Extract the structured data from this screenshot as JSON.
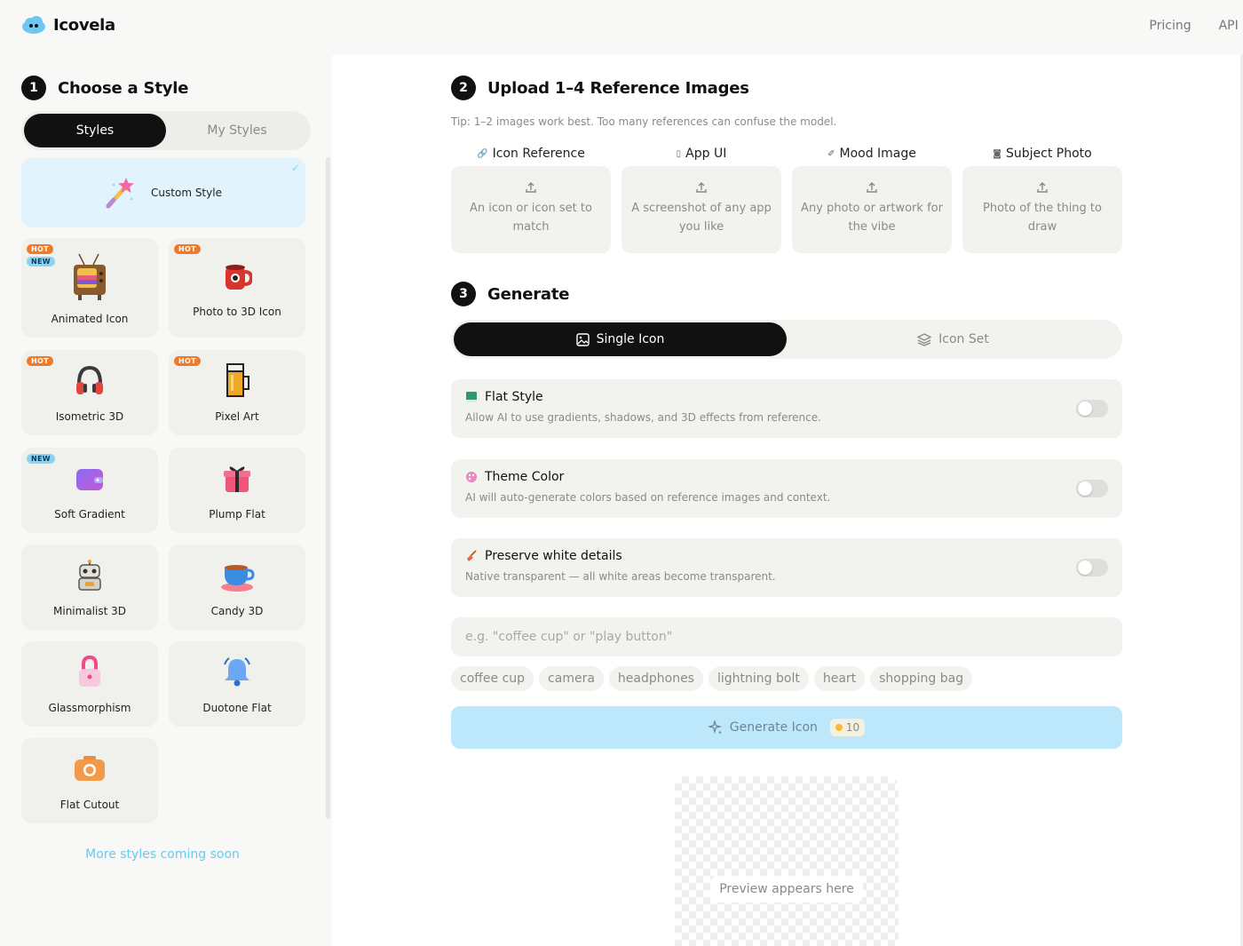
{
  "app": {
    "name": "Icovela"
  },
  "nav": {
    "items": [
      "Pricing",
      "API D"
    ]
  },
  "step1": {
    "number": "1",
    "title": "Choose a Style"
  },
  "style_tabs": {
    "styles": "Styles",
    "my_styles": "My Styles"
  },
  "custom_style": {
    "label": "Custom Style",
    "check": "✓"
  },
  "styles": [
    {
      "label": "Animated Icon",
      "badges": [
        "HOT",
        "NEW"
      ]
    },
    {
      "label": "Photo to 3D Icon",
      "badges": [
        "HOT"
      ]
    },
    {
      "label": "Isometric 3D",
      "badges": [
        "HOT"
      ]
    },
    {
      "label": "Pixel Art",
      "badges": [
        "HOT"
      ]
    },
    {
      "label": "Soft Gradient",
      "badges": [
        "NEW"
      ]
    },
    {
      "label": "Plump Flat",
      "badges": []
    },
    {
      "label": "Minimalist 3D",
      "badges": []
    },
    {
      "label": "Candy 3D",
      "badges": []
    },
    {
      "label": "Glassmorphism",
      "badges": []
    },
    {
      "label": "Duotone Flat",
      "badges": []
    },
    {
      "label": "Flat Cutout",
      "badges": []
    }
  ],
  "more_styles": "More styles coming soon",
  "step2": {
    "number": "2",
    "title": "Upload 1–4 Reference Images",
    "tip": "Tip: 1–2 images work best. Too many references can confuse the model.",
    "refs": [
      {
        "title": "Icon Reference",
        "desc": "An icon or icon set to match"
      },
      {
        "title": "App UI",
        "desc": "A screenshot of any app you like"
      },
      {
        "title": "Mood Image",
        "desc": "Any photo or artwork for the vibe"
      },
      {
        "title": "Subject Photo",
        "desc": "Photo of the thing to draw"
      }
    ]
  },
  "step3": {
    "number": "3",
    "title": "Generate",
    "modes": {
      "single": "Single Icon",
      "set": "Icon Set"
    },
    "options": [
      {
        "title": "Flat Style",
        "desc": "Allow AI to use gradients, shadows, and 3D effects from reference.",
        "enabled": false
      },
      {
        "title": "Theme Color",
        "desc": "AI will auto-generate colors based on reference images and context.",
        "enabled": false
      },
      {
        "title": "Preserve white details",
        "desc": "Native transparent — all white areas become transparent.",
        "enabled": false
      }
    ],
    "prompt": {
      "placeholder": "e.g. \"coffee cup\" or \"play button\"",
      "value": ""
    },
    "suggestions": [
      "coffee cup",
      "camera",
      "headphones",
      "lightning bolt",
      "heart",
      "shopping bag"
    ],
    "generate": {
      "label": "Generate Icon",
      "credits": "10"
    },
    "preview": {
      "label": "Preview appears here"
    }
  },
  "colors": {
    "accent": "#bde8fb",
    "hot": "#f07a2a",
    "new": "#8bd3f3",
    "custom_bg": "#e1f3fd"
  }
}
